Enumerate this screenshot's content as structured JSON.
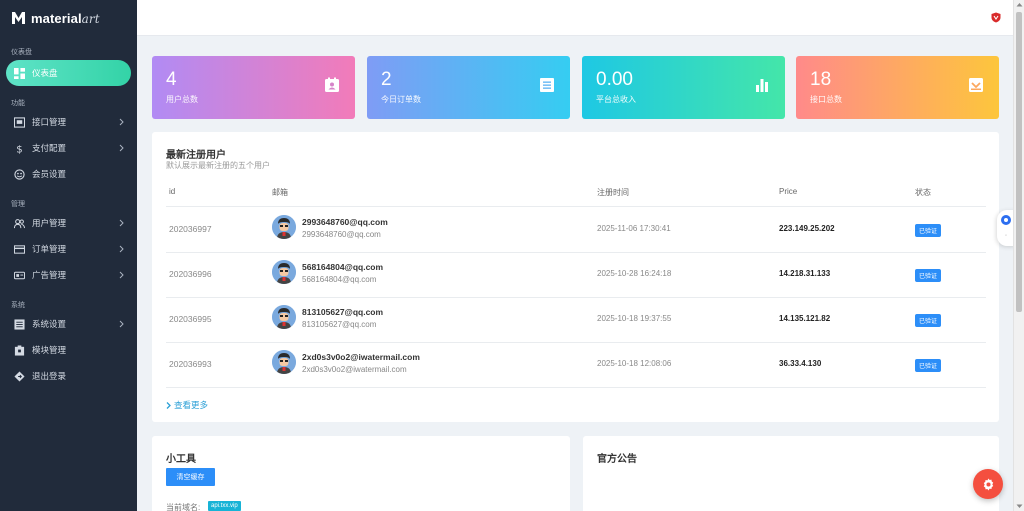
{
  "brand": {
    "name": "material",
    "suffix": "art"
  },
  "sidebar": {
    "sections": [
      {
        "title": "仪表盘"
      },
      {
        "title": "功能"
      },
      {
        "title": "管理"
      },
      {
        "title": "系统"
      }
    ],
    "items": [
      {
        "label": "仪表盘",
        "icon": "dashboard-icon"
      },
      {
        "label": "接口管理",
        "icon": "interface-icon"
      },
      {
        "label": "支付配置",
        "icon": "dollar-icon"
      },
      {
        "label": "会员设置",
        "icon": "member-icon"
      },
      {
        "label": "用户管理",
        "icon": "users-icon"
      },
      {
        "label": "订单管理",
        "icon": "card-icon"
      },
      {
        "label": "广告管理",
        "icon": "ad-icon"
      },
      {
        "label": "系统设置",
        "icon": "list-icon"
      },
      {
        "label": "模块管理",
        "icon": "module-icon"
      },
      {
        "label": "退出登录",
        "icon": "logout-icon"
      }
    ]
  },
  "stats": [
    {
      "value": "4",
      "label": "用户总数",
      "icon": "contact-icon"
    },
    {
      "value": "2",
      "label": "今日订单数",
      "icon": "document-icon"
    },
    {
      "value": "0.00",
      "label": "平台总收入",
      "icon": "bar-chart-icon"
    },
    {
      "value": "18",
      "label": "接口总数",
      "icon": "inbox-icon"
    }
  ],
  "users": {
    "title": "最新注册用户",
    "subtitle": "默认展示最新注册的五个用户",
    "columns": [
      "id",
      "邮箱",
      "注册时间",
      "Price",
      "状态"
    ],
    "rows": [
      {
        "id": "202036997",
        "email": "2993648760@qq.com",
        "email_sub": "2993648760@qq.com",
        "time": "2025-11-06 17:30:41",
        "ip": "223.149.25.202",
        "status": "已验证"
      },
      {
        "id": "202036996",
        "email": "568164804@qq.com",
        "email_sub": "568164804@qq.com",
        "time": "2025-10-28 16:24:18",
        "ip": "14.218.31.133",
        "status": "已验证"
      },
      {
        "id": "202036995",
        "email": "813105627@qq.com",
        "email_sub": "813105627@qq.com",
        "time": "2025-10-18 19:37:55",
        "ip": "14.135.121.82",
        "status": "已验证"
      },
      {
        "id": "202036993",
        "email": "2xd0s3v0o2@iwatermail.com",
        "email_sub": "2xd0s3v0o2@iwatermail.com",
        "time": "2025-10-18 12:08:06",
        "ip": "36.33.4.130",
        "status": "已验证"
      }
    ],
    "more": "查看更多"
  },
  "tools": {
    "title": "小工具",
    "clear_button": "清空缓存",
    "domain_label": "当前域名:",
    "domain_value": "api.txx.vip"
  },
  "notice": {
    "title": "官方公告"
  },
  "colors": {
    "sidebar_bg": "#212b3b",
    "active": "#33d3a7",
    "badge": "#2c8ef8",
    "fab": "#f44f3f"
  }
}
